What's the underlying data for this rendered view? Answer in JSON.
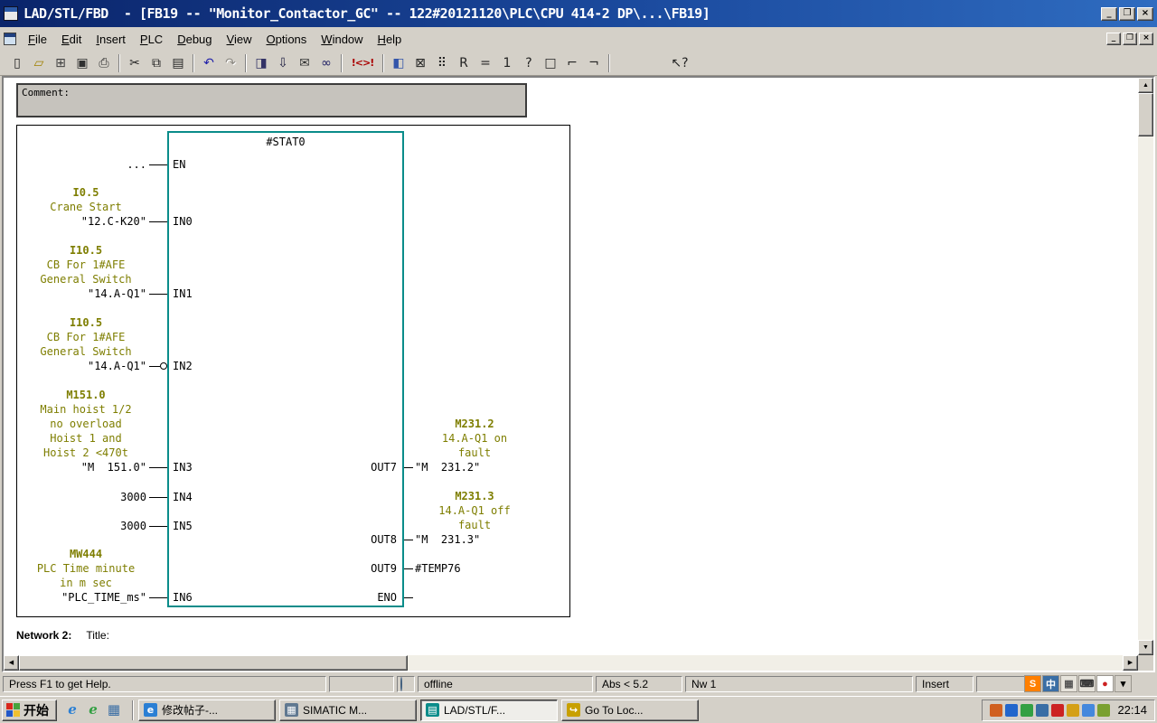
{
  "colors": {
    "title_gradient_start": "#0a246a",
    "title_gradient_end": "#2f6cc0",
    "block_border_teal": "#0a8c8a",
    "symbol_olive": "#7e7e00",
    "window_face": "#d4d0c8"
  },
  "icons": {
    "arrow_up": "▲",
    "arrow_down": "▼",
    "arrow_left": "◀",
    "arrow_right": "▶"
  },
  "titlebar": {
    "title": "LAD/STL/FBD  - [FB19 -- \"Monitor_Contactor_GC\" -- 122#20121120\\PLC\\CPU 414-2 DP\\...\\FB19]",
    "window_buttons": [
      {
        "name": "minimize-button",
        "glyph": "_"
      },
      {
        "name": "restore-button",
        "glyph": "❐"
      },
      {
        "name": "close-button",
        "glyph": "×"
      }
    ]
  },
  "menubar": {
    "items": [
      "File",
      "Edit",
      "Insert",
      "PLC",
      "Debug",
      "View",
      "Options",
      "Window",
      "Help"
    ]
  },
  "toolbar": {
    "icons": [
      {
        "name": "new-icon",
        "glyph": "▯"
      },
      {
        "name": "open-icon",
        "glyph": "▱",
        "color": "#a08000"
      },
      {
        "name": "open-online-icon",
        "glyph": "⊞",
        "color": "#404040"
      },
      {
        "name": "save-icon",
        "glyph": "▣",
        "color": "#303030"
      },
      {
        "name": "print-icon",
        "glyph": "⎙",
        "color": "#303030"
      },
      {
        "sep": true
      },
      {
        "name": "cut-icon",
        "glyph": "✂"
      },
      {
        "name": "copy-icon",
        "glyph": "⧉"
      },
      {
        "name": "paste-icon",
        "glyph": "▤"
      },
      {
        "sep": true
      },
      {
        "name": "undo-icon",
        "glyph": "↶",
        "color": "#2222aa"
      },
      {
        "name": "redo-icon",
        "glyph": "↷",
        "grayed": true
      },
      {
        "sep": true
      },
      {
        "name": "program-elements-icon",
        "glyph": "◨",
        "color": "#333366"
      },
      {
        "name": "download-icon",
        "glyph": "⇩",
        "color": "#222244"
      },
      {
        "name": "monitor-variable-icon",
        "glyph": "✉",
        "color": "#333333"
      },
      {
        "name": "observe-icon",
        "glyph": "∞",
        "color": "#222266"
      },
      {
        "sep": true
      },
      {
        "name": "symbolic-representation-icon",
        "glyph": "!<>!",
        "wide": true,
        "color": "#aa0000"
      },
      {
        "sep": true
      },
      {
        "name": "network-view-icon",
        "glyph": "◧",
        "color": "#3355aa"
      },
      {
        "name": "box-x-icon",
        "glyph": "⊠"
      },
      {
        "name": "address-identification-icon",
        "glyph": "⠿"
      },
      {
        "name": "relay-box-icon",
        "glyph": "R"
      },
      {
        "name": "assign-box-icon",
        "glyph": "="
      },
      {
        "name": "counter-box-icon",
        "glyph": "1"
      },
      {
        "name": "question-box-icon",
        "glyph": "?"
      },
      {
        "name": "empty-box-icon",
        "glyph": "□"
      },
      {
        "name": "open-branch-icon",
        "glyph": "⌐"
      },
      {
        "name": "close-branch-icon",
        "glyph": "¬"
      },
      {
        "sep": true
      },
      {
        "name": "help-cursor-icon",
        "glyph": "↖?",
        "gap": 62
      }
    ]
  },
  "editor": {
    "comment_label": "Comment:",
    "network2": {
      "label": "Network 2:",
      "title": "Title:"
    },
    "block": {
      "name": "#STAT0",
      "inputs": [
        {
          "pin": "EN",
          "operand": "..."
        },
        {
          "pin": "IN0",
          "address": "I0.5",
          "comments": [
            "Crane Start"
          ],
          "operand": "\"12.C-K20\""
        },
        {
          "pin": "IN1",
          "address": "I10.5",
          "comments": [
            "CB For 1#AFE",
            "General Switch"
          ],
          "operand": "\"14.A-Q1\""
        },
        {
          "pin": "IN2",
          "address": "I10.5",
          "comments": [
            "CB For 1#AFE",
            "General Switch"
          ],
          "operand": "\"14.A-Q1\"",
          "negated": true
        },
        {
          "pin": "IN3",
          "address": "M151.0",
          "comments": [
            "Main hoist 1/2",
            "no overload",
            "Hoist 1 and",
            "Hoist 2 <470t"
          ],
          "operand": "\"M  151.0\""
        },
        {
          "pin": "IN4",
          "operand": "3000"
        },
        {
          "pin": "IN5",
          "operand": "3000"
        },
        {
          "pin": "IN6",
          "address": "MW444",
          "comments": [
            "PLC Time minute",
            "in m sec"
          ],
          "operand": "\"PLC_TIME_ms\""
        }
      ],
      "outputs": [
        {
          "pin": "OUT7",
          "address": "M231.2",
          "comments": [
            "14.A-Q1 on",
            "fault"
          ],
          "operand": "\"M  231.2\""
        },
        {
          "pin": "OUT8",
          "address": "M231.3",
          "comments": [
            "14.A-Q1 off",
            "fault"
          ],
          "operand": "\"M  231.3\""
        },
        {
          "pin": "OUT9",
          "operand": "#TEMP76"
        },
        {
          "pin": "ENO"
        }
      ]
    }
  },
  "statusbar": {
    "help_text": "Press F1 to get Help.",
    "connection": "offline",
    "abs": "Abs < 5.2",
    "network": "Nw 1",
    "mode": "Insert",
    "language_icons": [
      {
        "name": "sogou-ime-icon",
        "glyph": "S",
        "bg": "#ff7f00",
        "fg": "#ffffff"
      },
      {
        "name": "chinese-mode-icon",
        "glyph": "中",
        "bg": "#3a6ea5",
        "fg": "#ffffff"
      },
      {
        "name": "punctuation-icon",
        "glyph": "▦",
        "bg": "#e6e3db",
        "fg": "#555555"
      },
      {
        "name": "soft-keyboard-icon",
        "glyph": "⌨",
        "bg": "#e6e3db",
        "fg": "#333333"
      },
      {
        "name": "ime-tool-icon",
        "glyph": "●",
        "bg": "#ffffff",
        "fg": "#cc2222"
      },
      {
        "name": "langbar-menu-icon",
        "glyph": "▾",
        "bg": "#d4d0c8",
        "fg": "#000000"
      }
    ]
  },
  "taskbar": {
    "start_label": "开始",
    "quick_launch": [
      {
        "name": "ie-icon",
        "glyph": "e",
        "color": "#2a7fd4"
      },
      {
        "name": "browser-icon",
        "glyph": "e",
        "color": "#33a043"
      },
      {
        "name": "show-desktop-icon",
        "glyph": "▦",
        "color": "#3a6ea5"
      }
    ],
    "buttons": [
      {
        "label": "修改帖子-...",
        "active": false,
        "icon": {
          "name": "ie-page-icon",
          "glyph": "e",
          "color": "#2a7fd4"
        }
      },
      {
        "label": "SIMATIC M...",
        "active": false,
        "icon": {
          "name": "simatic-manager-icon",
          "glyph": "▦",
          "color": "#607890"
        }
      },
      {
        "label": "LAD/STL/F...",
        "active": true,
        "icon": {
          "name": "ladstl-editor-icon",
          "glyph": "▤",
          "color": "#0a8c8a"
        }
      },
      {
        "label": "Go To Loc...",
        "active": false,
        "icon": {
          "name": "goto-location-icon",
          "glyph": "↪",
          "color": "#c8a000"
        }
      }
    ],
    "tray_icon_colors": [
      "#d06020",
      "#2266cc",
      "#33a043",
      "#3a6ea5",
      "#cc2222",
      "#d4a017",
      "#4488dd",
      "#7aa030"
    ],
    "clock": "22:14"
  }
}
